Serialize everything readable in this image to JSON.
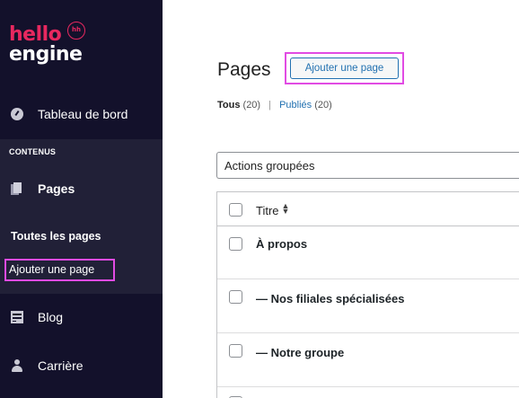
{
  "logo": {
    "hello": "hello",
    "engine": "engine",
    "badge": "hh"
  },
  "sidebar": {
    "dashboard_label": "Tableau de bord",
    "section_label": "CONTENUS",
    "pages_label": "Pages",
    "sub_all_pages": "Toutes les pages",
    "sub_add_page": "Ajouter une page",
    "blog_label": "Blog",
    "career_label": "Carrière"
  },
  "main": {
    "title": "Pages",
    "add_button": "Ajouter une page",
    "filters": {
      "all_label": "Tous",
      "all_count": "(20)",
      "separator": "|",
      "published_label": "Publiés",
      "published_count": "(20)"
    },
    "bulk_actions": "Actions groupées",
    "table": {
      "column_title": "Titre",
      "rows": [
        {
          "title": "À propos"
        },
        {
          "title": "— Nos filiales spécialisées"
        },
        {
          "title": "— Notre groupe"
        }
      ]
    }
  },
  "colors": {
    "sidebar_bg": "#13112b",
    "section_bg": "#212037",
    "brand_pink": "#e8285f",
    "highlight": "#e14be3",
    "link_blue": "#2271b1"
  }
}
